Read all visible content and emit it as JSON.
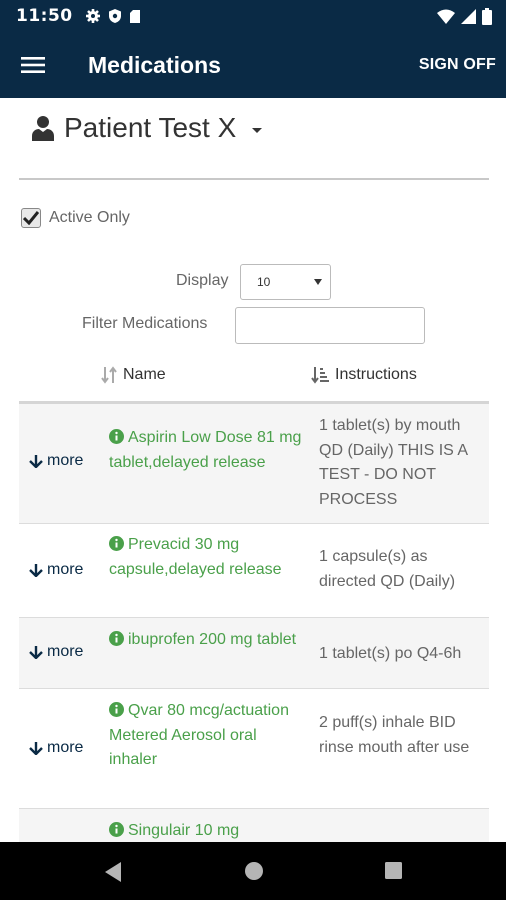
{
  "status_bar": {
    "time": "11:50",
    "left_icons": [
      "gear-icon",
      "shield-icon",
      "sd-card-icon"
    ],
    "right_icons": [
      "wifi-icon",
      "signal-icon",
      "battery-icon"
    ]
  },
  "app_bar": {
    "title": "Medications",
    "sign_off_label": "SIGN OFF",
    "menu_icon": "hamburger-menu-icon"
  },
  "patient": {
    "name": "Patient Test X",
    "icon": "user-icon"
  },
  "filters": {
    "active_only_label": "Active Only",
    "active_only_checked": true,
    "display_label": "Display",
    "display_value": "10",
    "filter_label": "Filter Medications",
    "filter_value": ""
  },
  "table": {
    "columns": [
      {
        "label": "Name",
        "sort_icon": "sort-icon"
      },
      {
        "label": "Instructions",
        "sort_icon": "sort-amount-icon"
      }
    ],
    "more_label": "more",
    "rows": [
      {
        "name": "Aspirin Low Dose 81 mg tablet,delayed release",
        "instructions": "1 tablet(s) by mouth QD (Daily) THIS IS A TEST - DO NOT PROCESS"
      },
      {
        "name": "Prevacid 30 mg capsule,delayed release",
        "instructions": "1 capsule(s) as directed QD (Daily)"
      },
      {
        "name": "ibuprofen 200 mg tablet",
        "instructions": "1 tablet(s) po Q4-6h"
      },
      {
        "name": "Qvar 80 mcg/actuation Metered Aerosol oral inhaler",
        "instructions": "2 puff(s) inhale BID rinse mouth after use"
      },
      {
        "name": "Singulair 10 mg",
        "instructions": ""
      }
    ]
  },
  "colors": {
    "header_bg": "#0a2a45",
    "med_name": "#4aa04a",
    "row_alt": "#f5f5f5"
  },
  "nav_bar": {
    "icons": [
      "back-icon",
      "home-icon",
      "recents-icon"
    ]
  }
}
